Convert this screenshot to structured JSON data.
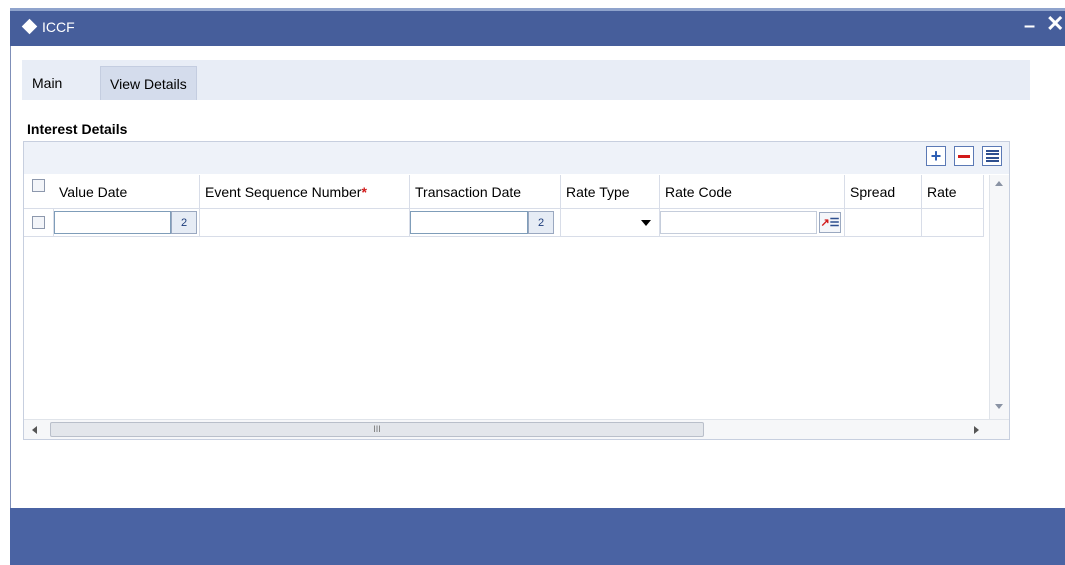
{
  "window": {
    "title": "ICCF",
    "minimize_glyph": "–",
    "close_glyph": "✕"
  },
  "tabs": [
    {
      "label": "Main",
      "active": false
    },
    {
      "label": "View Details",
      "active": true
    }
  ],
  "section": {
    "title": "Interest Details"
  },
  "grid": {
    "toolbar": {
      "add_glyph": "+",
      "delete_icon": "minus-icon",
      "single_view_icon": "single-record-view-icon"
    },
    "columns": [
      {
        "label": "Value Date",
        "required": false
      },
      {
        "label": "Event Sequence Number",
        "required": true
      },
      {
        "label": "Transaction Date",
        "required": false
      },
      {
        "label": "Rate Type",
        "required": false
      },
      {
        "label": "Rate Code",
        "required": false
      },
      {
        "label": "Spread",
        "required": false
      },
      {
        "label": "Rate",
        "required": false
      }
    ],
    "required_marker": "*",
    "row": {
      "value_date": "",
      "event_sequence_number": "",
      "transaction_date": "",
      "rate_type": "",
      "rate_code": "",
      "spread": "",
      "rate": ""
    },
    "calendar_button_text": "2",
    "scrollbar_thumb_grip": "III"
  },
  "colors": {
    "titlebar": "#465e9b",
    "footer": "#4a63a3",
    "tabbar": "#e8edf6",
    "required": "#d21a1a"
  }
}
